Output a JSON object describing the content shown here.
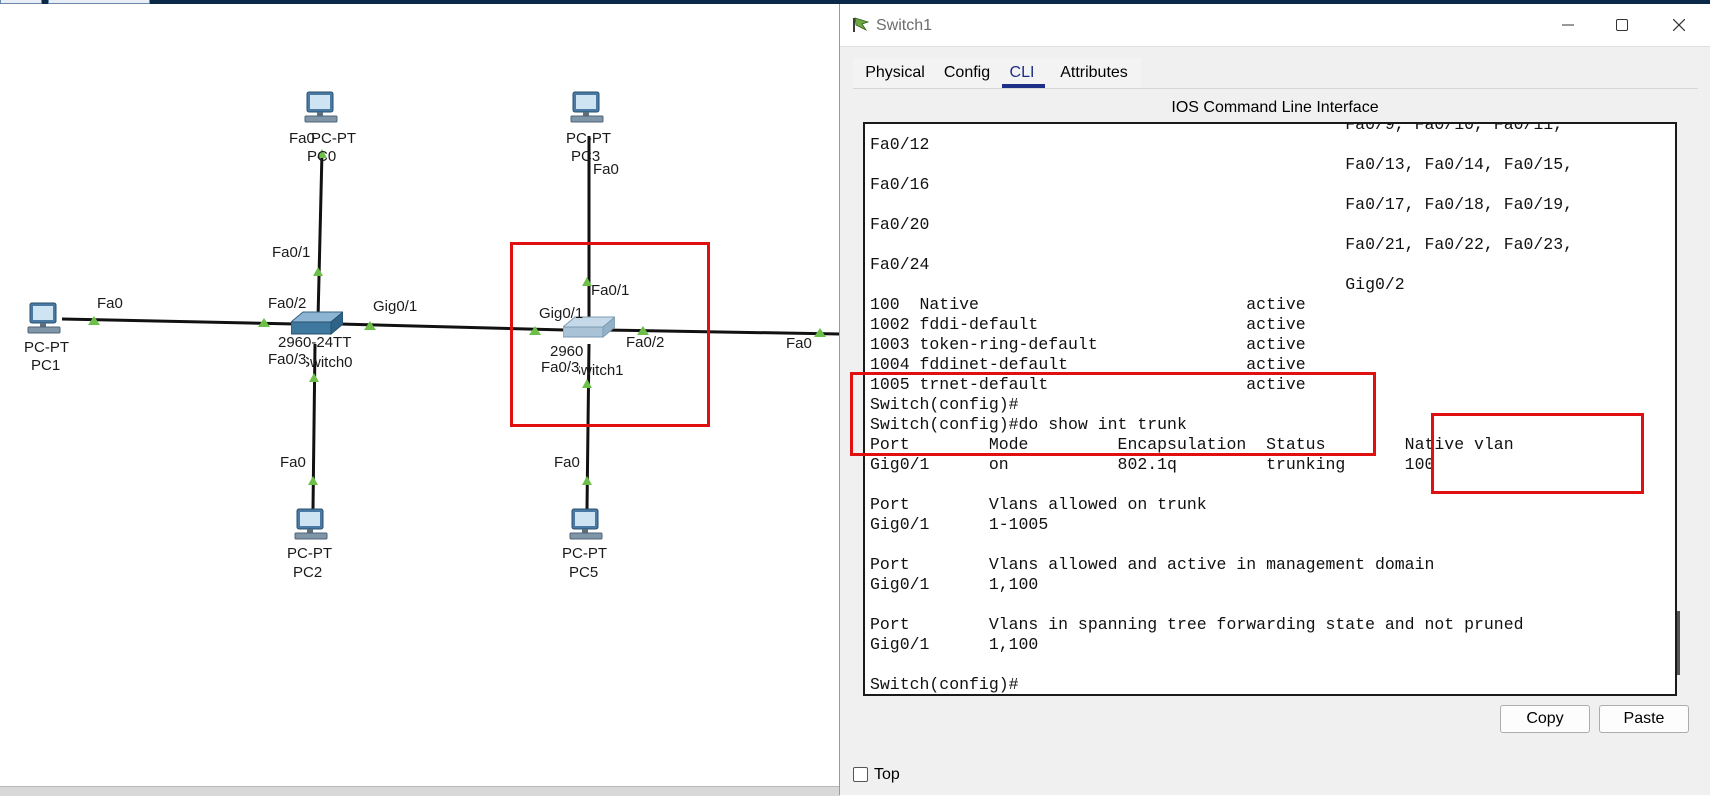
{
  "window": {
    "title": "Switch1",
    "tabs": [
      "Physical",
      "Config",
      "CLI",
      "Attributes"
    ],
    "active_tab": "CLI",
    "header": "IOS Command Line Interface",
    "buttons": {
      "copy": "Copy",
      "paste": "Paste"
    },
    "top_checkbox": {
      "label": "Top",
      "checked": false
    }
  },
  "terminal": {
    "lines": [
      "                                                Fa0/9, Fa0/10, Fa0/11,",
      "Fa0/12",
      "                                                Fa0/13, Fa0/14, Fa0/15,",
      "Fa0/16",
      "                                                Fa0/17, Fa0/18, Fa0/19,",
      "Fa0/20",
      "                                                Fa0/21, Fa0/22, Fa0/23,",
      "Fa0/24",
      "                                                Gig0/2",
      "100  Native                           active",
      "1002 fddi-default                     active",
      "1003 token-ring-default               active",
      "1004 fddinet-default                  active",
      "1005 trnet-default                    active",
      "Switch(config)#",
      "Switch(config)#do show int trunk",
      "Port        Mode         Encapsulation  Status        Native vlan",
      "Gig0/1      on           802.1q         trunking      100",
      "",
      "Port        Vlans allowed on trunk",
      "Gig0/1      1-1005",
      "",
      "Port        Vlans allowed and active in management domain",
      "Gig0/1      1,100",
      "",
      "Port        Vlans in spanning tree forwarding state and not pruned",
      "Gig0/1      1,100",
      "",
      "Switch(config)#"
    ]
  },
  "topology": {
    "devices": {
      "pc0": {
        "type": "PC-PT",
        "name": "PC0"
      },
      "pc1": {
        "type": "PC-PT",
        "name": "PC1"
      },
      "pc2": {
        "type": "PC-PT",
        "name": "PC2"
      },
      "pc3": {
        "type": "PC-PT",
        "name": "PC3"
      },
      "pc5": {
        "type": "PC-PT",
        "name": "PC5"
      },
      "switch0": {
        "model": "2960-24TT",
        "name": "Switch0"
      },
      "switch1": {
        "model": "2960",
        "name": "Switch1"
      }
    },
    "port_labels": {
      "pc0_fa0": "Fa0",
      "sw0_fa0_1": "Fa0/1",
      "pc1_fa0": "Fa0",
      "sw0_fa0_2": "Fa0/2",
      "sw0_gig0_1": "Gig0/1",
      "sw0_fa0_3": "Fa0/3",
      "pc2_fa0": "Fa0",
      "pc3_fa0": "Fa0",
      "sw1_fa0_1": "Fa0/1",
      "sw1_gig0_1": "Gig0/1",
      "sw1_fa0_2": "Fa0/2",
      "sw1_fa0_3": "Fa0/3",
      "pc5_fa0": "Fa0",
      "right_fa0": "Fa0"
    }
  },
  "colors": {
    "highlight": "#e01010",
    "cli_tab": "#1d2f86",
    "link_arrow": "#6cc04a"
  }
}
